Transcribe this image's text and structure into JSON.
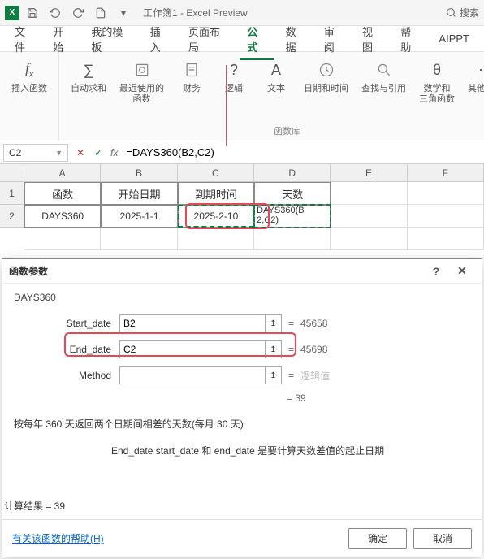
{
  "title": "工作簿1 - Excel Preview",
  "search_label": "搜索",
  "tabs": [
    "文件",
    "开始",
    "我的模板",
    "插入",
    "页面布局",
    "公式",
    "数据",
    "审阅",
    "视图",
    "帮助",
    "AIPPT"
  ],
  "active_tab_index": 5,
  "ribbon": {
    "insert_fn": "插入函数",
    "autosum": "自动求和",
    "recent": "最近使用的\n函数",
    "financial": "财务",
    "logical": "逻辑",
    "text": "文本",
    "datetime": "日期和时间",
    "lookup": "查找与引用",
    "math": "数学和\n三角函数",
    "other": "其他函数",
    "group_label": "函数库"
  },
  "name_box": "C2",
  "formula": "=DAYS360(B2,C2)",
  "columns": [
    "A",
    "B",
    "C",
    "D",
    "E",
    "F"
  ],
  "rows": [
    "1",
    "2"
  ],
  "grid": {
    "r1": [
      "函数",
      "开始日期",
      "到期时间",
      "天数"
    ],
    "r2": [
      "DAYS360",
      "2025-1-1",
      "2025-2-10",
      "DAYS360(B\n2,C2)"
    ]
  },
  "dialog": {
    "title": "函数参数",
    "fn": "DAYS360",
    "params": [
      {
        "label": "Start_date",
        "value": "B2",
        "result": "45658"
      },
      {
        "label": "End_date",
        "value": "C2",
        "result": "45698"
      },
      {
        "label": "Method",
        "value": "",
        "result": "逻辑值"
      }
    ],
    "eq_result": "= 39",
    "desc": "按每年 360 天返回两个日期间相差的天数(每月 30 天)",
    "desc2": "End_date   start_date 和 end_date 是要计算天数差值的起止日期",
    "calc_label": "计算结果 =  39",
    "help": "有关该函数的帮助(H)",
    "ok": "确定",
    "cancel": "取消"
  }
}
